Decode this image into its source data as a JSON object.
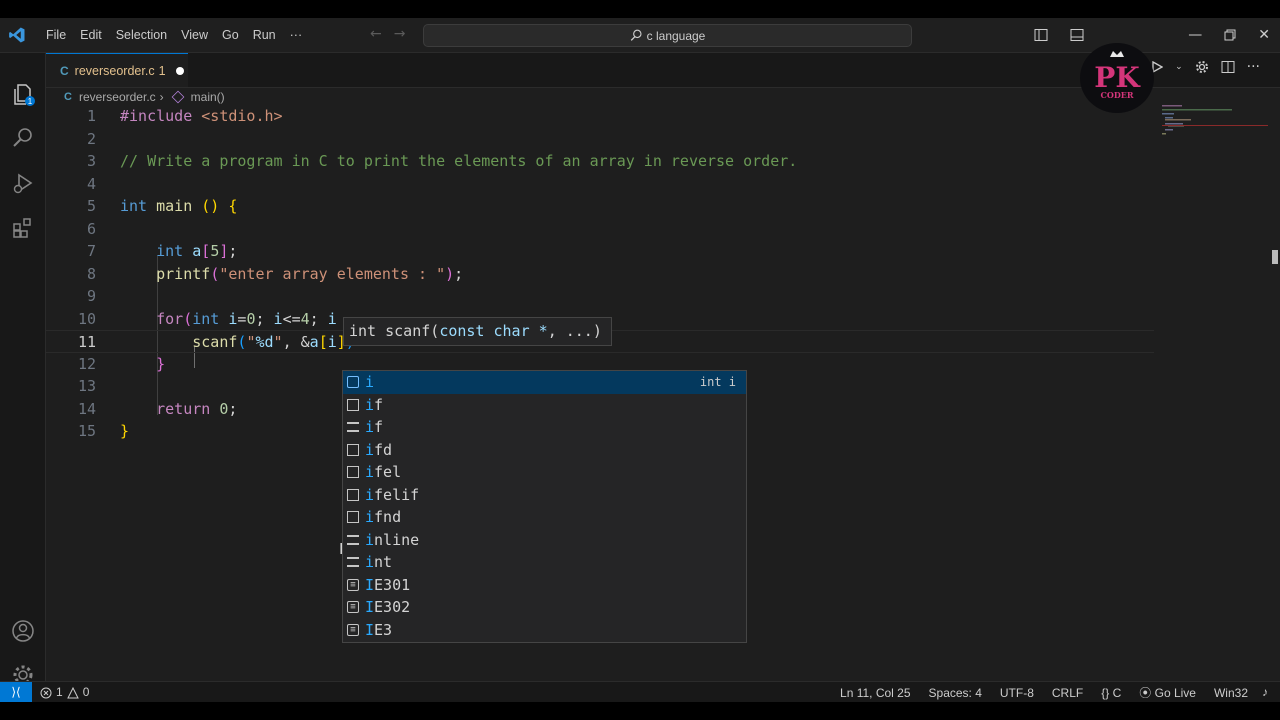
{
  "titlebar": {
    "menu": [
      "File",
      "Edit",
      "Selection",
      "View",
      "Go",
      "Run",
      "···"
    ],
    "search": "c language"
  },
  "tab": {
    "lang_badge": "C",
    "filename": "reverseorder.c",
    "problem_count": "1"
  },
  "breadcrumb": {
    "lang_badge": "C",
    "file": "reverseorder.c",
    "separator": "›",
    "symbol": "main()"
  },
  "code": {
    "line_numbers": [
      "1",
      "2",
      "3",
      "4",
      "5",
      "6",
      "7",
      "8",
      "9",
      "10",
      "11",
      "12",
      "13",
      "14",
      "15"
    ],
    "active_line": "11"
  },
  "parameter_hint": {
    "text_before": "int scanf(",
    "param": "const char *",
    "text_after": ", ...)"
  },
  "suggestions": [
    {
      "match": "i",
      "rest": "",
      "icon": "variable-icon",
      "detail": "int i"
    },
    {
      "match": "i",
      "rest": "f",
      "icon": "snippet-icon",
      "detail": ""
    },
    {
      "match": "i",
      "rest": "f",
      "icon": "keyword-icon",
      "detail": ""
    },
    {
      "match": "i",
      "rest": "fd",
      "icon": "snippet-icon",
      "detail": ""
    },
    {
      "match": "i",
      "rest": "fel",
      "icon": "snippet-icon",
      "detail": ""
    },
    {
      "match": "i",
      "rest": "felif",
      "icon": "snippet-icon",
      "detail": ""
    },
    {
      "match": "i",
      "rest": "fnd",
      "icon": "snippet-icon",
      "detail": ""
    },
    {
      "match": "i",
      "rest": "nline",
      "icon": "keyword-icon",
      "detail": ""
    },
    {
      "match": "i",
      "rest": "nt",
      "icon": "keyword-icon",
      "detail": ""
    },
    {
      "match": "I",
      "rest": "E301",
      "icon": "text-icon",
      "detail": ""
    },
    {
      "match": "I",
      "rest": "E302",
      "icon": "text-icon",
      "detail": ""
    },
    {
      "match": "I",
      "rest": "E3",
      "icon": "text-icon",
      "detail": ""
    }
  ],
  "statusbar": {
    "errors": "1",
    "warnings": "0",
    "position": "Ln 11, Col 25",
    "spaces": "Spaces: 4",
    "encoding": "UTF-8",
    "eol": "CRLF",
    "language": "C",
    "golive": "Go Live",
    "platform": "Win32"
  },
  "watermark": {
    "text": "PK",
    "subtext": "CODER"
  },
  "colors": {
    "accent": "#0078d4",
    "selection": "#04395e",
    "keyword": "#569cd6",
    "comment": "#6a9955",
    "string": "#ce9178"
  }
}
